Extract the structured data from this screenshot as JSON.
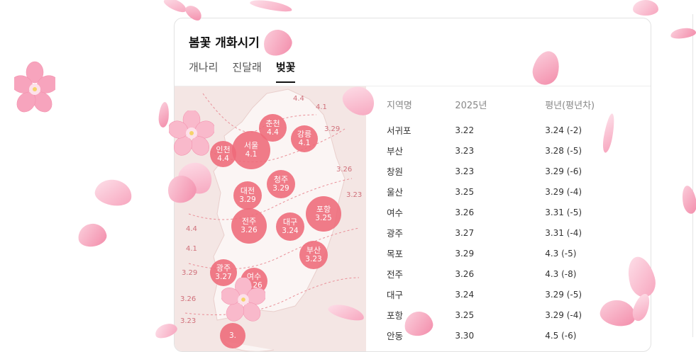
{
  "card": {
    "title": "봄꽃 개화시기"
  },
  "tabs": [
    {
      "label": "개나리",
      "active": false
    },
    {
      "label": "진달래",
      "active": false
    },
    {
      "label": "벚꽃",
      "active": true
    }
  ],
  "map": {
    "bubbles": [
      {
        "name": "춘천",
        "value": "4.4"
      },
      {
        "name": "서울",
        "value": "4.1"
      },
      {
        "name": "인천",
        "value": "4.4"
      },
      {
        "name": "강릉",
        "value": "4.1"
      },
      {
        "name": "청주",
        "value": "3.29"
      },
      {
        "name": "대전",
        "value": "3.29"
      },
      {
        "name": "포항",
        "value": "3.25"
      },
      {
        "name": "전주",
        "value": "3.26"
      },
      {
        "name": "대구",
        "value": "3.24"
      },
      {
        "name": "부산",
        "value": "3.23"
      },
      {
        "name": "광주",
        "value": "3.27"
      },
      {
        "name": "여수",
        "value": "3.26"
      },
      {
        "name": "",
        "value": "3."
      }
    ],
    "isolines": [
      "4.4",
      "4.1",
      "3.29",
      "3.26",
      "3.23",
      "4.4",
      "4.1",
      "3.29",
      "3.26",
      "3.23"
    ]
  },
  "table": {
    "headers": [
      "지역명",
      "2025년",
      "평년(평년차)"
    ],
    "rows": [
      [
        "서귀포",
        "3.22",
        "3.24 (-2)"
      ],
      [
        "부산",
        "3.23",
        "3.28 (-5)"
      ],
      [
        "창원",
        "3.23",
        "3.29 (-6)"
      ],
      [
        "울산",
        "3.25",
        "3.29 (-4)"
      ],
      [
        "여수",
        "3.26",
        "3.31 (-5)"
      ],
      [
        "광주",
        "3.27",
        "3.31 (-4)"
      ],
      [
        "목포",
        "3.29",
        "4.3 (-5)"
      ],
      [
        "전주",
        "3.26",
        "4.3 (-8)"
      ],
      [
        "대구",
        "3.24",
        "3.29 (-5)"
      ],
      [
        "포항",
        "3.25",
        "3.29 (-4)"
      ],
      [
        "안동",
        "3.30",
        "4.5 (-6)"
      ]
    ]
  },
  "colors": {
    "bubble": "#ef6b7a",
    "map_bg": "#f4e6e4",
    "petal": "#f7a4bd"
  },
  "decor": {
    "petals": "cherry-blossom-petal-icon",
    "flowers": "cherry-blossom-flower-icon"
  }
}
